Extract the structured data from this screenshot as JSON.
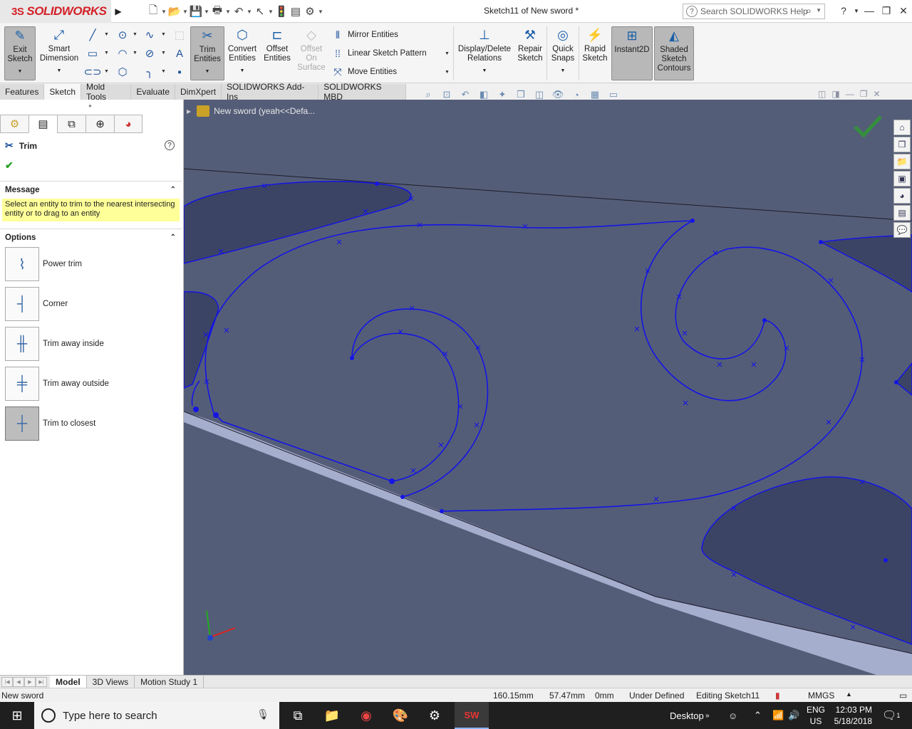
{
  "app": {
    "logo_ds": "3S",
    "logo_text": "SOLIDWORKS",
    "doc_title": "Sketch11 of New sword *"
  },
  "search": {
    "placeholder": "Search SOLIDWORKS Help"
  },
  "ribbon": {
    "exit_sketch": "Exit Sketch",
    "smart_dimension": "Smart Dimension",
    "trim_entities": "Trim Entities",
    "convert_entities": "Convert Entities",
    "offset_entities": "Offset Entities",
    "offset_on_surface": "Offset On Surface",
    "mirror_entities": "Mirror Entities",
    "linear_sketch_pattern": "Linear Sketch Pattern",
    "move_entities": "Move Entities",
    "display_delete_relations": "Display/Delete Relations",
    "repair_sketch": "Repair Sketch",
    "quick_snaps": "Quick Snaps",
    "rapid_sketch": "Rapid Sketch",
    "instant2d": "Instant2D",
    "shaded_sketch_contours": "Shaded Sketch Contours"
  },
  "tabs": [
    "Features",
    "Sketch",
    "Mold Tools",
    "Evaluate",
    "DimXpert",
    "SOLIDWORKS Add-Ins",
    "SOLIDWORKS MBD"
  ],
  "panel": {
    "title": "Trim",
    "message_header": "Message",
    "message_text": "Select an entity to trim to the nearest intersecting entity or to drag to an entity",
    "options_header": "Options",
    "options": [
      "Power trim",
      "Corner",
      "Trim away inside",
      "Trim away outside",
      "Trim to closest"
    ]
  },
  "viewport": {
    "tree_label": "New sword  (yeah<<Defa..."
  },
  "bottom_tabs": [
    "Model",
    "3D Views",
    "Motion Study 1"
  ],
  "status": {
    "doc_name": "New sword",
    "x": "160.15mm",
    "y": "57.47mm",
    "z": "0mm",
    "state": "Under Defined",
    "editing": "Editing Sketch11",
    "units": "MMGS"
  },
  "taskbar": {
    "search_placeholder": "Type here to search",
    "desktop": "Desktop",
    "lang_top": "ENG",
    "lang_bottom": "US",
    "time": "12:03 PM",
    "date": "5/18/2018",
    "notif_count": "1"
  },
  "colors": {
    "viewport_bg": "#545d78",
    "sketch_line": "#1414e6",
    "region_fill": "#3c4466",
    "bar_fill": "#a6aece",
    "accent": "#d32027"
  }
}
